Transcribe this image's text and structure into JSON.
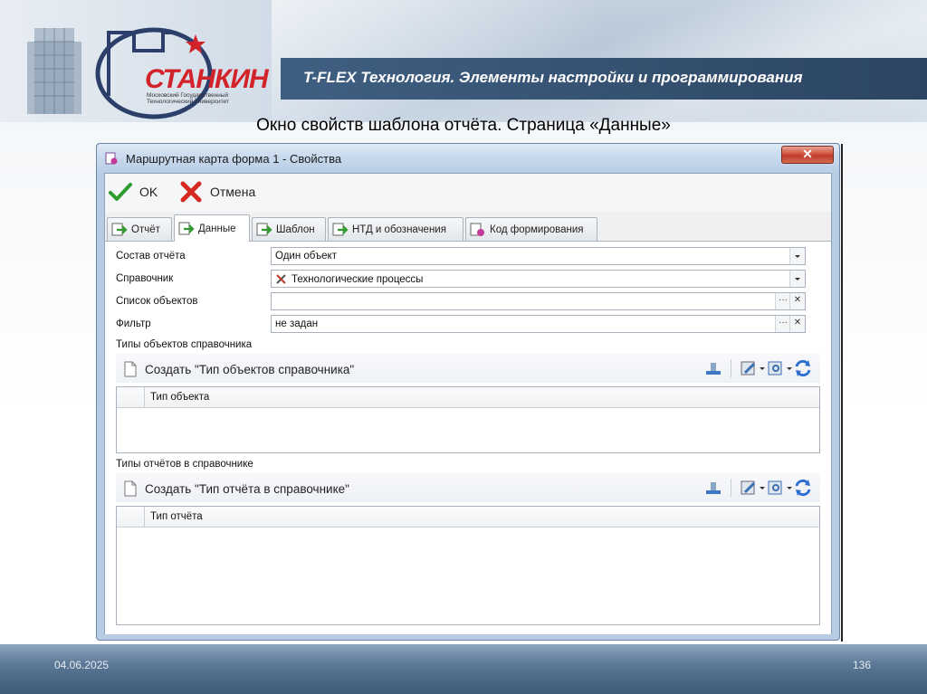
{
  "header": {
    "band_title": "T-FLEX Технология. Элементы настройки и программирования",
    "logo_name": "СТАНКИН",
    "logo_subtitle": "Московский Государственный Технологический Университет"
  },
  "slide_title": "Окно свойств шаблона отчёта. Страница «Данные»",
  "footer": {
    "date": "04.06.2025",
    "page": "136"
  },
  "window": {
    "title": "Маршрутная карта форма 1 - Свойства",
    "close_label": "✕",
    "toolbar": {
      "ok_label": "OK",
      "cancel_label": "Отмена"
    },
    "tabs": [
      {
        "label": "Отчёт"
      },
      {
        "label": "Данные"
      },
      {
        "label": "Шаблон"
      },
      {
        "label": "НТД и обозначения"
      },
      {
        "label": "Код формирования"
      }
    ],
    "fields": {
      "composition": {
        "label": "Состав отчёта",
        "value": "Один объект"
      },
      "reference": {
        "label": "Справочник",
        "value": "Технологические процессы"
      },
      "object_list": {
        "label": "Список объектов",
        "value": ""
      },
      "filter": {
        "label": "Фильтр",
        "value": "не задан"
      }
    },
    "section1": {
      "label": "Типы объектов справочника",
      "create_label": "Создать \"Тип объектов справочника\"",
      "column": "Тип объекта"
    },
    "section2": {
      "label": "Типы отчётов в справочнике",
      "create_label": "Создать \"Тип отчёта в справочнике\"",
      "column": "Тип отчёта"
    },
    "button_glyphs": {
      "ellipsis": "···",
      "clear": "✕"
    }
  },
  "colors": {
    "band": "#34506f",
    "accent_red": "#d2232a",
    "window_frame": "#b7cbe3"
  }
}
